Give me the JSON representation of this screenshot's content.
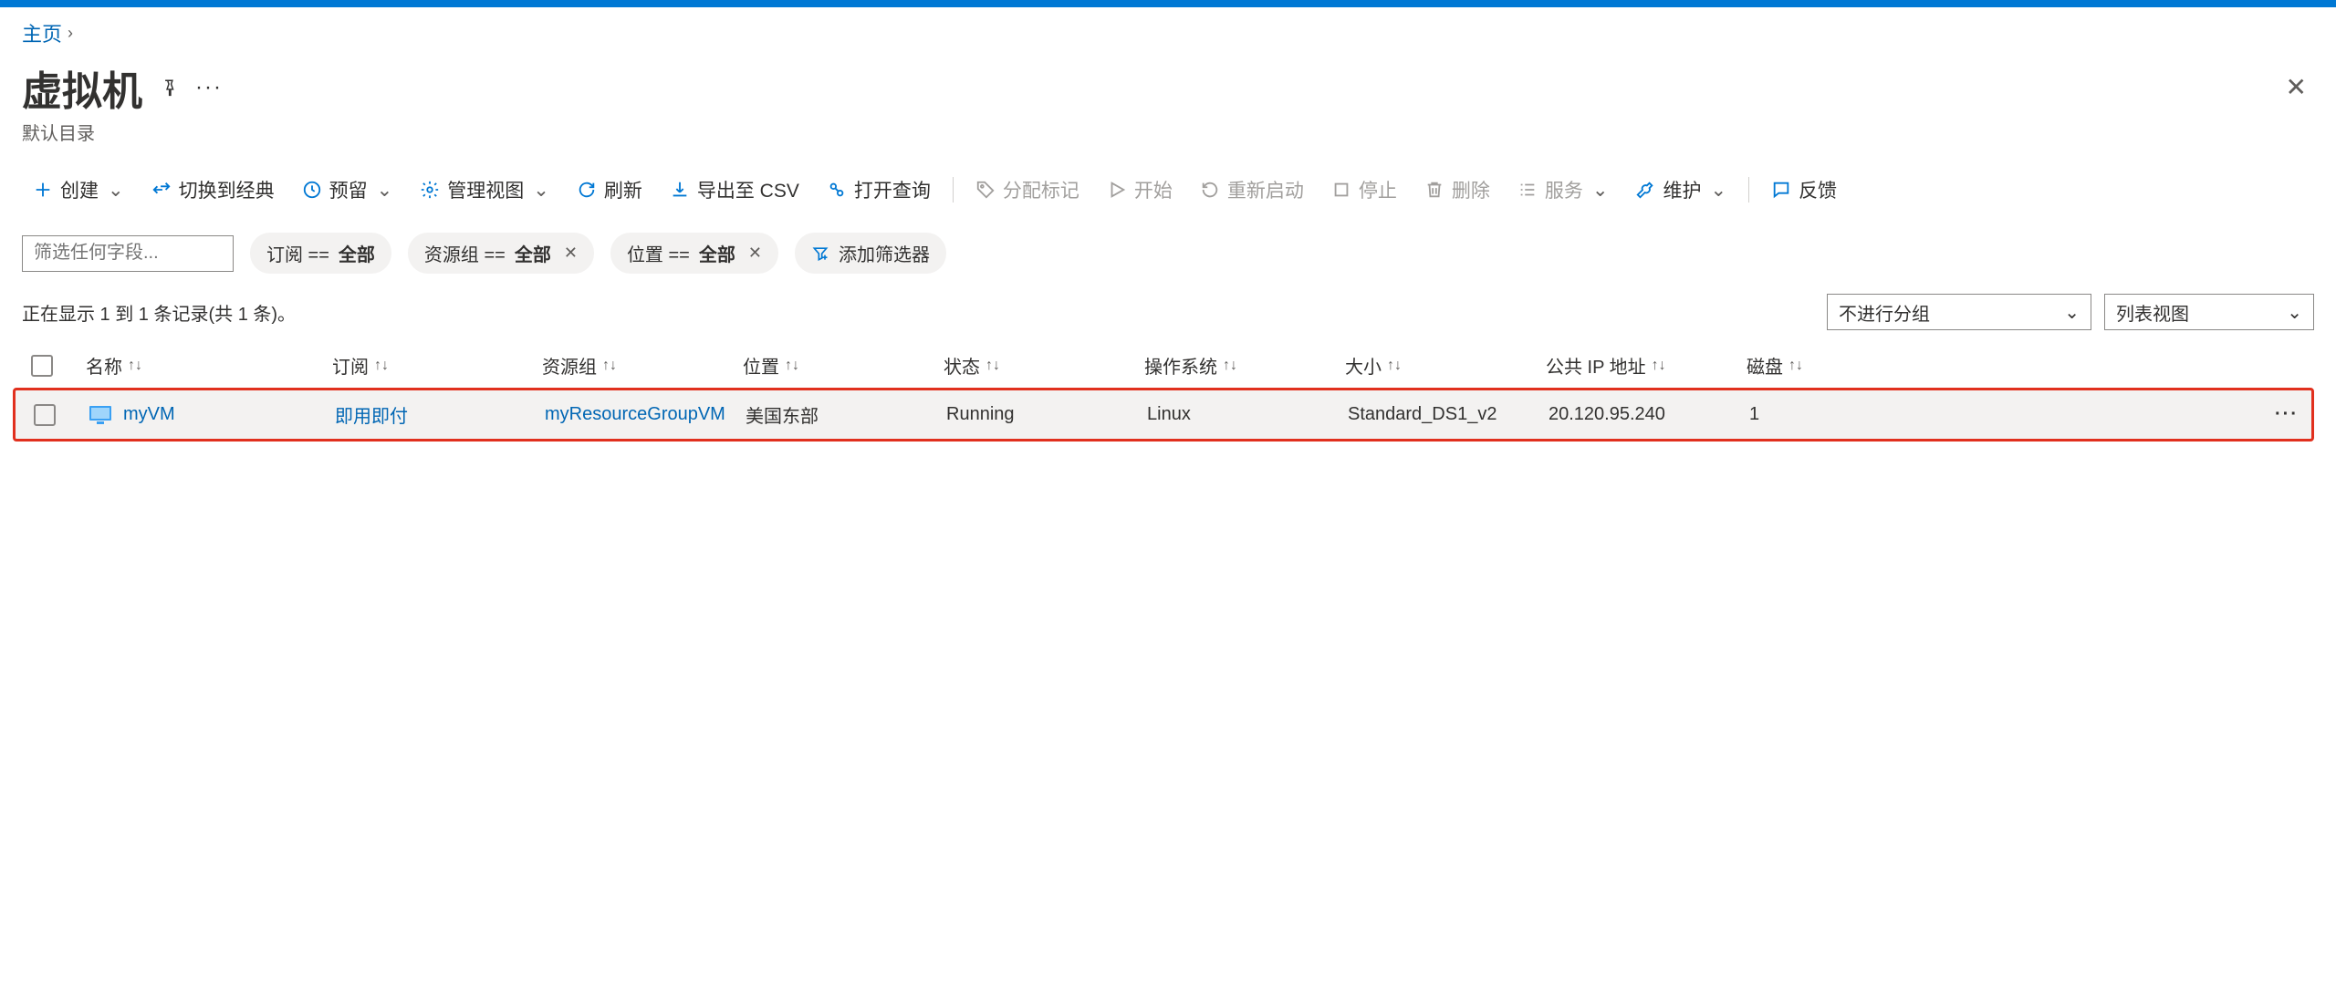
{
  "breadcrumb": {
    "home": "主页"
  },
  "header": {
    "title": "虚拟机",
    "subtitle": "默认目录"
  },
  "toolbar": {
    "create": "创建",
    "switch_classic": "切换到经典",
    "reserve": "预留",
    "manage_view": "管理视图",
    "refresh": "刷新",
    "export_csv": "导出至 CSV",
    "open_query": "打开查询",
    "assign_tags": "分配标记",
    "start": "开始",
    "restart": "重新启动",
    "stop": "停止",
    "delete": "删除",
    "services": "服务",
    "maintenance": "维护",
    "feedback": "反馈"
  },
  "filters": {
    "placeholder": "筛选任何字段...",
    "subscription_prefix": "订阅 == ",
    "subscription_value": "全部",
    "resourcegroup_prefix": "资源组 == ",
    "resourcegroup_value": "全部",
    "location_prefix": "位置 == ",
    "location_value": "全部",
    "add_filter": "添加筛选器"
  },
  "status": {
    "text": "正在显示 1 到 1 条记录(共 1 条)。",
    "group_by": "不进行分组",
    "view_mode": "列表视图"
  },
  "columns": {
    "name": "名称",
    "subscription": "订阅",
    "resource_group": "资源组",
    "location": "位置",
    "status": "状态",
    "os": "操作系统",
    "size": "大小",
    "public_ip": "公共 IP 地址",
    "disks": "磁盘"
  },
  "rows": [
    {
      "name": "myVM",
      "subscription": "即用即付",
      "resource_group": "myResourceGroupVM",
      "location": "美国东部",
      "status": "Running",
      "os": "Linux",
      "size": "Standard_DS1_v2",
      "public_ip": "20.120.95.240",
      "disks": "1"
    }
  ]
}
